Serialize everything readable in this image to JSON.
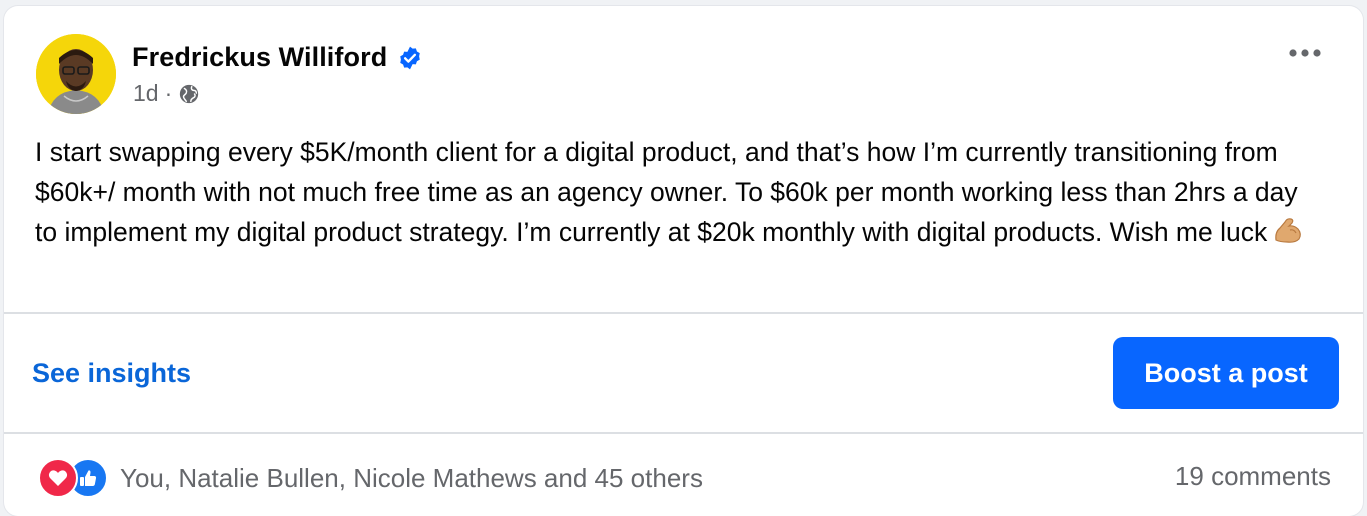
{
  "post": {
    "author": "Fredrickus Williford",
    "time": "1d",
    "separator": "·",
    "privacy_icon": "globe-icon",
    "verified_icon": "verified-badge-icon",
    "more_icon": "more-options-icon",
    "text": "I start swapping every $5K/month client for a digital product, and that’s how I’m currently transitioning from $60k+/ month with not much free time as an agency owner. To $60k per month working less than 2hrs a day to implement my digital product strategy. I’m currently at $20k monthly with digital products. Wish me luck",
    "emoji_icon": "flexed-biceps-icon"
  },
  "actions": {
    "insights_label": "See insights",
    "boost_label": "Boost a post"
  },
  "engagement": {
    "reaction_icons": [
      "love-reaction-icon",
      "like-reaction-icon"
    ],
    "reactors_text": "You, Natalie Bullen, Nicole Mathews and 45 others",
    "comments_text": "19 comments"
  },
  "colors": {
    "accent": "#0866ff",
    "link": "#0a66d8",
    "secondary_text": "#65676b",
    "love": "#f02849",
    "like": "#1877f2"
  }
}
